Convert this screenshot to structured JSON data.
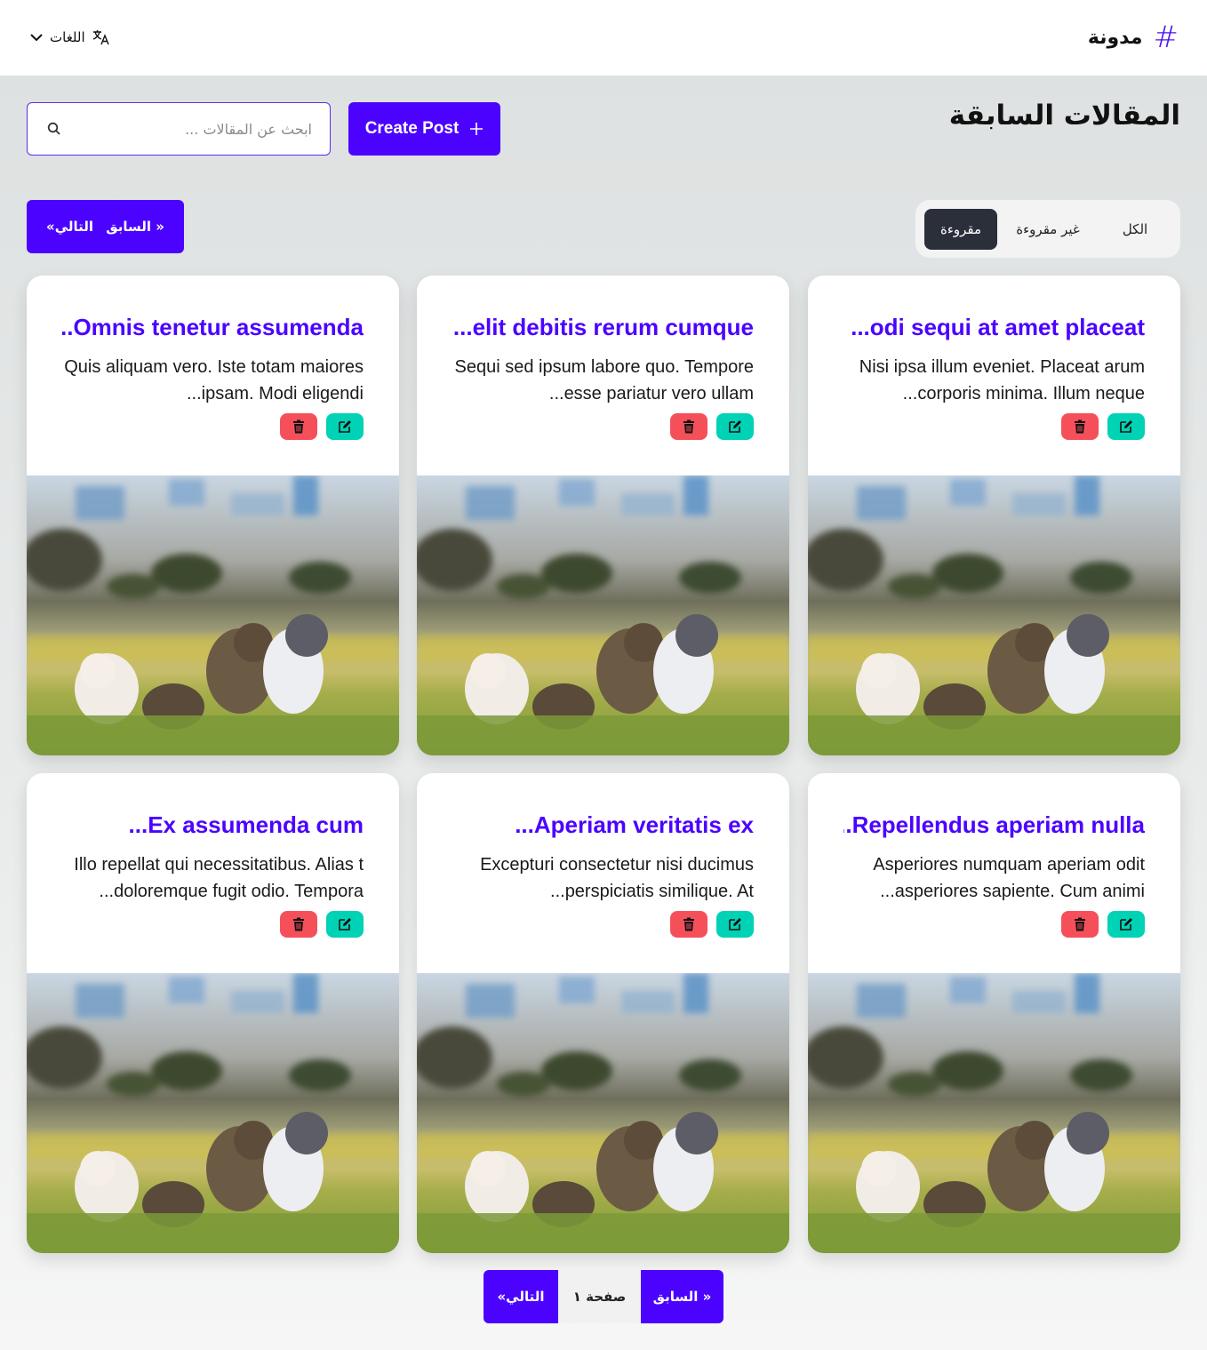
{
  "nav": {
    "brand_name": "مدونة",
    "brand_icon": "#",
    "languages_label": "اللغات"
  },
  "header": {
    "title": "المقالات السابقة",
    "create_label": "Create Post",
    "search_placeholder": "ابحث عن المقالات ..."
  },
  "pager_top": {
    "prev": "« السابق",
    "next": "التالي»"
  },
  "filters": [
    {
      "label": "الكل",
      "active": false
    },
    {
      "label": "غير مقروءة",
      "active": false
    },
    {
      "label": "مقروءة",
      "active": true
    }
  ],
  "posts": [
    {
      "title": "odi sequi at amet placeat...",
      "excerpt": "Nisi ipsa illum eveniet. Placeat arum corporis minima. Illum neque..."
    },
    {
      "title": "elit debitis rerum cumque...",
      "excerpt": "Sequi sed ipsum labore quo. Tempore esse pariatur vero ullam..."
    },
    {
      "title": "Omnis tenetur assumenda...",
      "excerpt": "Quis aliquam vero. Iste totam maiores ipsam. Modi eligendi..."
    },
    {
      "title": "Repellendus aperiam nulla...",
      "excerpt": "Asperiores numquam aperiam odit asperiores sapiente. Cum animi..."
    },
    {
      "title": "Aperiam veritatis ex...",
      "excerpt": "Excepturi consectetur nisi ducimus perspiciatis similique. At..."
    },
    {
      "title": "Ex assumenda cum...",
      "excerpt": "Illo repellat qui necessitatibus. Alias t doloremque fugit odio. Tempora..."
    }
  ],
  "pager_bottom": {
    "prev": "« السابق",
    "page": "صفحة ١",
    "next": "التالي»"
  },
  "colors": {
    "accent": "#4b03ff",
    "edit": "#00d2b5",
    "delete": "#f5505a",
    "active_filter": "#2b2f3a"
  }
}
